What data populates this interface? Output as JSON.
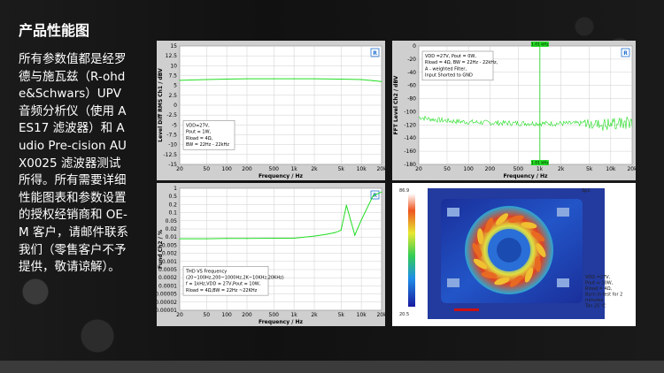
{
  "title": "产品性能图",
  "description": "所有参数值都是经罗德与施瓦兹（R-ohde&Schwars）UPV 音频分析仪（使用 AES17 滤波器）和 Audio Pre-cision AUX0025 滤波器测试所得。所有需要详细性能图表和参数设置的授权经销商和 OE-M 客户，请邮件联系我们（零售客户不予提供，敬请谅解）。",
  "charts": [
    {
      "name": "frequency-response",
      "type": "line",
      "ylabel": "Level Diff RMS Ch1 / dBV",
      "xlabel": "Frequency / Hz",
      "x_ticks": [
        "20",
        "50",
        "100",
        "200",
        "500",
        "1k",
        "2k",
        "5k",
        "10k",
        "20k"
      ],
      "y_ticks": [
        "15",
        "12.5",
        "10",
        "7.5",
        "5",
        "2.5",
        "0",
        "-2.5",
        "-5",
        "-7.5",
        "-10",
        "-12.5",
        "-15"
      ],
      "ylim": [
        -15,
        15
      ],
      "legend": [
        "VDD=27V,",
        "Pout = 1W,",
        "Rload = 4Ω,",
        "BW = 22Hz - 22kHz"
      ],
      "series": [
        {
          "x": [
            20,
            50,
            100,
            200,
            500,
            1000,
            2000,
            5000,
            10000,
            15000,
            20000
          ],
          "y": [
            6.3,
            6.5,
            6.6,
            6.7,
            6.7,
            6.7,
            6.7,
            6.6,
            6.5,
            6.2,
            6.0
          ]
        }
      ]
    },
    {
      "name": "fft-spectrum",
      "type": "line",
      "ylabel": "FFT Level Ch2 / dBV",
      "xlabel": "Frequency / Hz",
      "x_ticks": [
        "20",
        "50",
        "100",
        "200",
        "500",
        "1k",
        "2k",
        "5k",
        "10k",
        "20k"
      ],
      "y_ticks": [
        "0",
        "-20",
        "-40",
        "-60",
        "-80",
        "-100",
        "-120",
        "-140",
        "-160",
        "-180"
      ],
      "ylim": [
        -180,
        0
      ],
      "marker_top": "1.01 kHz",
      "marker_bottom": "1.01 kHz",
      "legend": [
        "VDD =27V, Pout = 0W,",
        "Rload = 4Ω, BW = 22Hz - 22kHz,",
        "A - weighted Filter,",
        "Input Shorted to GND"
      ]
    },
    {
      "name": "thd-vs-frequency",
      "type": "line",
      "ylabel": "Fund Ch2 / %",
      "xlabel": "Frequency / Hz",
      "x_ticks": [
        "20",
        "50",
        "100",
        "200",
        "500",
        "1k",
        "2k",
        "5k",
        "10k",
        "20k"
      ],
      "y_ticks": [
        "1",
        "0.5",
        "0.2",
        "0.1",
        "0.05",
        "0.02",
        "0.01",
        "0.005",
        "0.002",
        "0.001",
        "0.0005",
        "0.0002",
        "0.0001",
        "0.00005",
        "0.00002",
        "0.00001"
      ],
      "legend": [
        "THD VS Frequency",
        "(20~100Hz,200~1000Hz,2K~10KHz,20KHz)",
        "f = 1kHz,VDD = 27V,Pout = 10W,",
        "Rload = 4Ω,BW = 22Hz ~22KHz"
      ],
      "series": [
        {
          "x": [
            20,
            50,
            100,
            200,
            500,
            1000,
            2000,
            3000,
            4000,
            5000,
            6000,
            8000,
            10000,
            15000,
            20000
          ],
          "y": [
            0.0085,
            0.0085,
            0.0088,
            0.0088,
            0.009,
            0.009,
            0.011,
            0.013,
            0.015,
            0.019,
            0.2,
            0.012,
            0.05,
            0.5,
            0.7
          ]
        }
      ]
    }
  ],
  "thermal": {
    "labels": [
      "VDD =27V,",
      "Pout = 10W,",
      "Rload = 4Ω,",
      "Burn in test for 2",
      "minutes",
      "Tan 25 ℃"
    ],
    "scale_min": "20.5",
    "scale_max": "86.9",
    "spot_label": "Sp1"
  },
  "colors": {
    "curve": "#22dd22",
    "panel_bg": "#cfcfcf",
    "plot_bg": "#ffffff",
    "logo": "#1f6fd1"
  }
}
